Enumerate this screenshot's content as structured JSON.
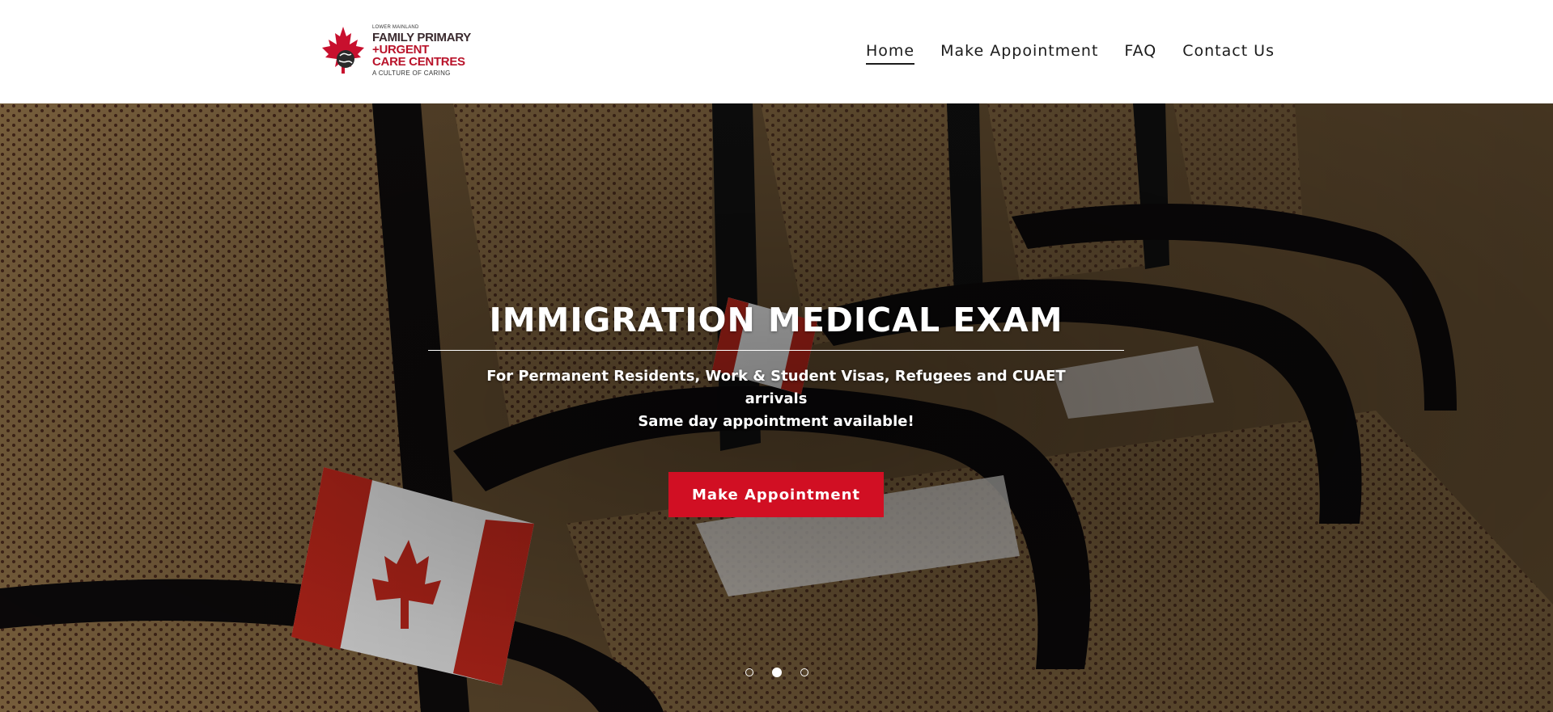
{
  "brand": {
    "top_line": "LOWER MAINLAND",
    "line1": "FAMILY PRIMARY",
    "line2": "+URGENT",
    "line3": "CARE CENTRES",
    "tagline": "A CULTURE OF CARING",
    "logo_icon": "maple-leaf-globe-icon",
    "color": "#b9132a"
  },
  "nav": {
    "items": [
      {
        "label": "Home",
        "active": true
      },
      {
        "label": "Make Appointment",
        "active": false
      },
      {
        "label": "FAQ",
        "active": false
      },
      {
        "label": "Contact Us",
        "active": false
      }
    ]
  },
  "hero": {
    "title": "IMMIGRATION MEDICAL EXAM",
    "subtitle": "For Permanent Residents, Work & Student Visas, Refugees and CUAET arrivals",
    "subtitle2": "Same day appointment available!",
    "cta_label": "Make Appointment",
    "cta_color": "#d10f23",
    "carousel": {
      "count": 3,
      "active_index": 1
    }
  }
}
